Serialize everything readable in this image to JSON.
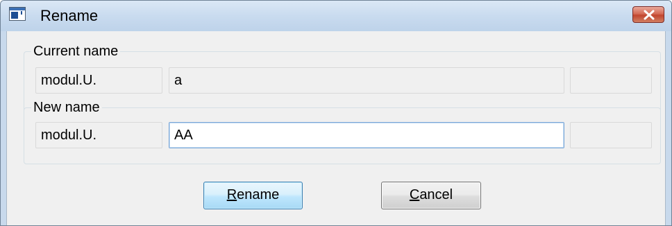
{
  "window": {
    "title": "Rename",
    "icon": "app-window-icon",
    "close_icon": "close-icon",
    "close_accent": "#c94a33"
  },
  "current_name": {
    "legend": "Current name",
    "prefix": "modul.U.",
    "name": "a",
    "suffix": ""
  },
  "new_name": {
    "legend": "New name",
    "prefix": "modul.U.",
    "name_value": "AA",
    "suffix": ""
  },
  "buttons": {
    "rename": {
      "mnemonic": "R",
      "rest": "ename"
    },
    "cancel": {
      "mnemonic": "C",
      "rest": "ancel"
    }
  }
}
